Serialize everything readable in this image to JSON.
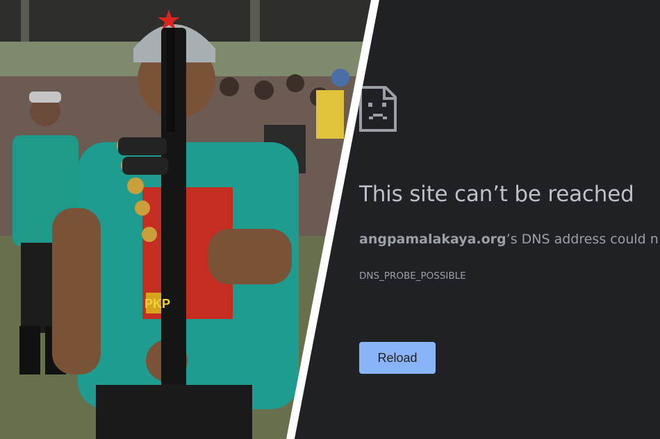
{
  "error_page": {
    "title": "This site can’t be reached",
    "host": "angpamalakaya.org",
    "detail_suffix": "’s DNS address could n",
    "error_code": "DNS_PROBE_POSSIBLE",
    "reload_label": "Reload",
    "icon": "sad-page-icon"
  },
  "photo": {
    "shirt_text": "PKP"
  },
  "colors": {
    "page_background": "#202124",
    "title_text": "#bdc1c6",
    "secondary_text": "#9aa0a6",
    "button_background": "#8ab4f8",
    "button_text": "#202124",
    "divider": "#ffffff"
  }
}
